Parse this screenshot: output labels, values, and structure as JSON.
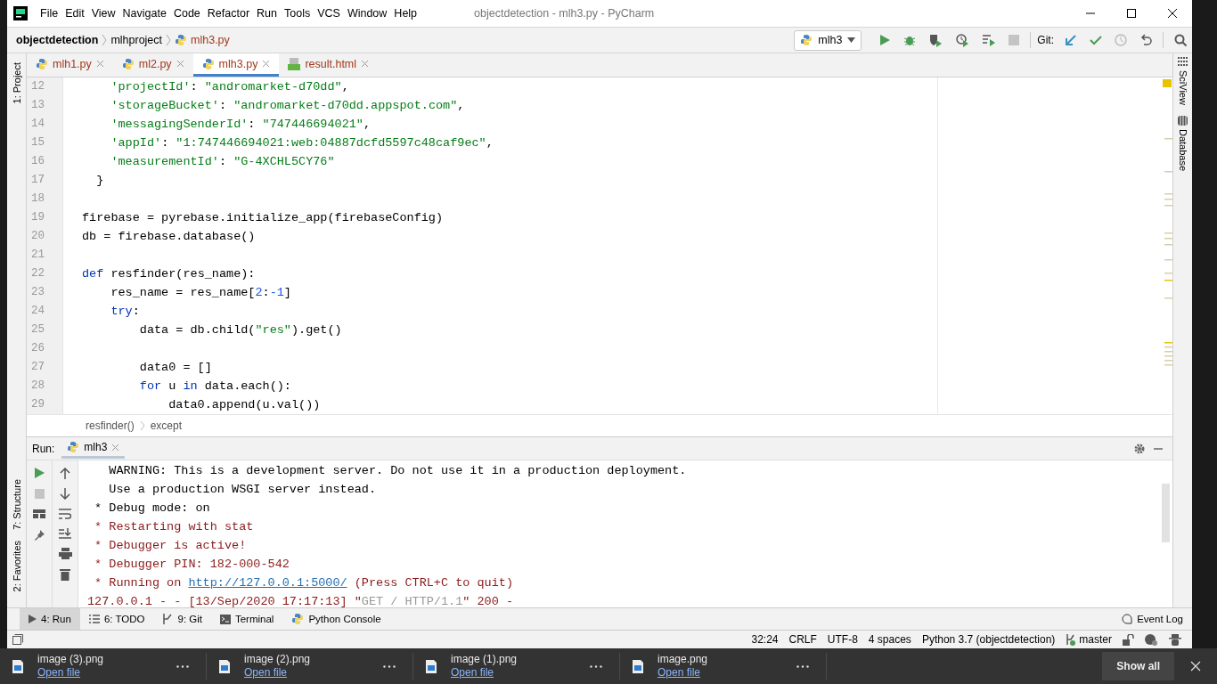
{
  "window": {
    "title": "objectdetection - mlh3.py - PyCharm"
  },
  "menu": [
    "File",
    "Edit",
    "View",
    "Navigate",
    "Code",
    "Refactor",
    "Run",
    "Tools",
    "VCS",
    "Window",
    "Help"
  ],
  "breadcrumbs": [
    {
      "label": "objectdetection",
      "kind": "project"
    },
    {
      "label": "mlhproject",
      "kind": "folder"
    },
    {
      "label": "mlh3.py",
      "kind": "file"
    }
  ],
  "run_config": "mlh3",
  "git_label": "Git:",
  "editor_tabs": [
    {
      "label": "mlh1.py",
      "kind": "python",
      "selected": false
    },
    {
      "label": "ml2.py",
      "kind": "python",
      "selected": false
    },
    {
      "label": "mlh3.py",
      "kind": "python",
      "selected": true
    },
    {
      "label": "result.html",
      "kind": "html",
      "selected": false
    }
  ],
  "left_tool_tabs": [
    {
      "label": "1: Project",
      "kind": "project"
    },
    {
      "label": "7: Structure",
      "kind": "structure"
    },
    {
      "label": "2: Favorites",
      "kind": "favorites"
    }
  ],
  "right_tool_tabs": [
    {
      "label": "SciView",
      "kind": "sciview"
    },
    {
      "label": "Database",
      "kind": "database"
    }
  ],
  "code_lines": [
    {
      "number": "12",
      "tokens": [
        {
          "t": "    'projectId'",
          "kind": "str"
        },
        {
          "t": ": ",
          "kind": "plain"
        },
        {
          "t": "\"andromarket-d70dd\"",
          "kind": "str"
        },
        {
          "t": ",",
          "kind": "plain"
        }
      ]
    },
    {
      "number": "13",
      "tokens": [
        {
          "t": "    'storageBucket'",
          "kind": "str"
        },
        {
          "t": ": ",
          "kind": "plain"
        },
        {
          "t": "\"andromarket-d70dd.appspot.com\"",
          "kind": "str"
        },
        {
          "t": ",",
          "kind": "plain"
        }
      ]
    },
    {
      "number": "14",
      "tokens": [
        {
          "t": "    'messagingSenderId'",
          "kind": "str"
        },
        {
          "t": ": ",
          "kind": "plain"
        },
        {
          "t": "\"747446694021\"",
          "kind": "str"
        },
        {
          "t": ",",
          "kind": "plain"
        }
      ]
    },
    {
      "number": "15",
      "tokens": [
        {
          "t": "    'appId'",
          "kind": "str"
        },
        {
          "t": ": ",
          "kind": "plain"
        },
        {
          "t": "\"1:747446694021:web:04887dcfd5597c48caf9ec\"",
          "kind": "str"
        },
        {
          "t": ",",
          "kind": "plain"
        }
      ]
    },
    {
      "number": "16",
      "tokens": [
        {
          "t": "    'measurementId'",
          "kind": "str"
        },
        {
          "t": ": ",
          "kind": "plain"
        },
        {
          "t": "\"G-4XCHL5CY76\"",
          "kind": "str"
        }
      ]
    },
    {
      "number": "17",
      "tokens": [
        {
          "t": "  }",
          "kind": "plain"
        }
      ]
    },
    {
      "number": "18"
    },
    {
      "number": "19",
      "tokens": [
        {
          "t": "firebase = pyrebase.initialize_app(firebaseConfig)",
          "kind": "plain"
        }
      ]
    },
    {
      "number": "20",
      "tokens": [
        {
          "t": "db = firebase.database()",
          "kind": "plain"
        }
      ]
    },
    {
      "number": "21"
    },
    {
      "number": "22",
      "tokens": [
        {
          "t": "def",
          "kind": "kw"
        },
        {
          "t": " resfinder(res_name):",
          "kind": "plain"
        }
      ]
    },
    {
      "number": "23",
      "tokens": [
        {
          "t": "    res_name = res_name[",
          "kind": "plain"
        },
        {
          "t": "2",
          "kind": "num"
        },
        {
          "t": ":",
          "kind": "plain"
        },
        {
          "t": "-1",
          "kind": "num"
        },
        {
          "t": "]",
          "kind": "plain"
        }
      ]
    },
    {
      "number": "24",
      "tokens": [
        {
          "t": "    try",
          "kind": "kw"
        },
        {
          "t": ":",
          "kind": "plain"
        }
      ]
    },
    {
      "number": "25",
      "tokens": [
        {
          "t": "        data = db.child(",
          "kind": "plain"
        },
        {
          "t": "\"res\"",
          "kind": "str"
        },
        {
          "t": ").get()",
          "kind": "plain"
        }
      ]
    },
    {
      "number": "26"
    },
    {
      "number": "27",
      "tokens": [
        {
          "t": "        data0 = []",
          "kind": "plain"
        }
      ]
    },
    {
      "number": "28",
      "tokens": [
        {
          "t": "        for",
          "kind": "kw"
        },
        {
          "t": " u ",
          "kind": "plain"
        },
        {
          "t": "in",
          "kind": "kw"
        },
        {
          "t": " data.each():",
          "kind": "plain"
        }
      ]
    },
    {
      "number": "29",
      "tokens": [
        {
          "t": "            data0.append(u.val())",
          "kind": "plain"
        }
      ]
    }
  ],
  "code_breadcrumbs": [
    "resfinder()",
    "except"
  ],
  "run_panel": {
    "title": "Run:",
    "tab": "mlh3",
    "lines": [
      {
        "tokens": [
          {
            "t": "   WARNING: This is a development server. Do not use it in a production deployment.",
            "kind": "plain"
          }
        ]
      },
      {
        "tokens": [
          {
            "t": "   Use a production WSGI server instead.",
            "kind": "plain"
          }
        ]
      },
      {
        "tokens": [
          {
            "t": " * Debug mode: on",
            "kind": "plain"
          }
        ]
      },
      {
        "tokens": [
          {
            "t": " * Restarting with stat",
            "kind": "red"
          }
        ]
      },
      {
        "tokens": [
          {
            "t": " * Debugger is active!",
            "kind": "red"
          }
        ]
      },
      {
        "tokens": [
          {
            "t": " * Debugger PIN: 182-000-542",
            "kind": "red"
          }
        ]
      },
      {
        "tokens": [
          {
            "t": " * Running on ",
            "kind": "red"
          },
          {
            "t": "http://127.0.0.1:5000/",
            "kind": "link"
          },
          {
            "t": " (Press CTRL+C to quit)",
            "kind": "red"
          }
        ]
      },
      {
        "tokens": [
          {
            "t": "127.0.0.1 - - [13/Sep/2020 17:17:13] \"",
            "kind": "red"
          },
          {
            "t": "GET / HTTP/1.1",
            "kind": "gray"
          },
          {
            "t": "\" 200 -",
            "kind": "red"
          }
        ]
      }
    ]
  },
  "bottom_tools": [
    {
      "label": "4: Run",
      "kind": "run",
      "selected": true
    },
    {
      "label": "6: TODO",
      "kind": "todo",
      "selected": false
    },
    {
      "label": "9: Git",
      "kind": "git",
      "selected": false
    },
    {
      "label": "Terminal",
      "kind": "terminal",
      "selected": false
    },
    {
      "label": "Python Console",
      "kind": "console",
      "selected": false
    }
  ],
  "event_log": "Event Log",
  "status": [
    "32:24",
    "CRLF",
    "UTF-8",
    "4 spaces",
    "Python 3.7 (objectdetection)"
  ],
  "branch": "master",
  "downloads": {
    "items": [
      {
        "name": "image (3).png",
        "action": "Open file"
      },
      {
        "name": "image (2).png",
        "action": "Open file"
      },
      {
        "name": "image (1).png",
        "action": "Open file"
      },
      {
        "name": "image.png",
        "action": "Open file"
      }
    ],
    "show_all": "Show all"
  }
}
